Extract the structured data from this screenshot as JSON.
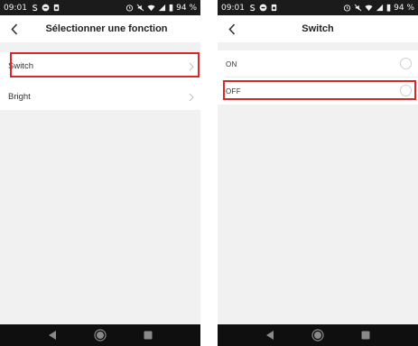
{
  "status_bar": {
    "time": "09:01",
    "battery": "94 %"
  },
  "screen_left": {
    "title": "Sélectionner une fonction",
    "items": [
      {
        "label": "Switch",
        "icon": "chevron-right-icon"
      },
      {
        "label": "Bright",
        "icon": "chevron-right-icon"
      }
    ]
  },
  "screen_right": {
    "title": "Switch",
    "options": [
      {
        "label": "ON",
        "selected": false
      },
      {
        "label": "OFF",
        "selected": false
      }
    ]
  },
  "colors": {
    "highlight": "#d62a2a",
    "status_bar": "#1b1b1b",
    "nav_bar": "#0f0f0f",
    "background": "#f1f1f1"
  },
  "icons": [
    "back-arrow-icon",
    "chevron-right-icon",
    "nav-back-icon",
    "nav-home-icon",
    "nav-recents-icon",
    "wifi-icon",
    "signal-icon",
    "battery-icon",
    "alarm-icon"
  ]
}
